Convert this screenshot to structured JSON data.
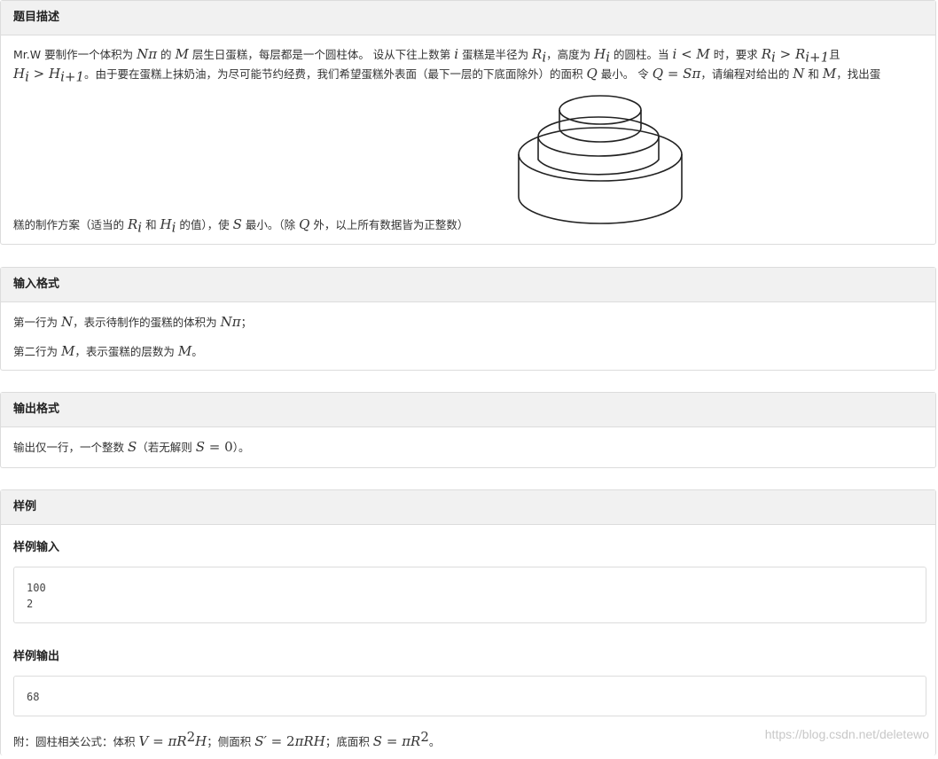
{
  "desc": {
    "header": "题目描述",
    "l1_a": "Mr.W 要制作一个体积为 ",
    "l1_b": " 的 ",
    "l1_c": " 层生日蛋糕，每层都是一个圆柱体。 设从下往上数第 ",
    "l1_d": " 蛋糕是半径为 ",
    "l1_e": "，高度为 ",
    "l1_f": " 的圆柱。当 ",
    "l1_g": " 时，要求 ",
    "l1_h": "且",
    "l2_a": "。由于要在蛋糕上抹奶油，为尽可能节约经费，我们希望蛋糕外表面（最下一层的下底面除外）的面积 ",
    "l2_b": " 最小。 令 ",
    "l2_c": "，请编程对给出的 ",
    "l2_d": " 和 ",
    "l2_e": "，找出蛋",
    "l3_a": "糕的制作方案（适当的 ",
    "l3_b": " 和 ",
    "l3_c": " 的值），使 ",
    "l3_d": " 最小。（除 ",
    "l3_e": " 外，以上所有数据皆为正整数）"
  },
  "input_format": {
    "header": "输入格式",
    "l1_a": "第一行为 ",
    "l1_b": "，表示待制作的蛋糕的体积为 ",
    "l1_c": "；",
    "l2_a": "第二行为 ",
    "l2_b": "，表示蛋糕的层数为 ",
    "l2_c": "。"
  },
  "output_format": {
    "header": "输出格式",
    "l1_a": "输出仅一行，一个整数 ",
    "l1_b": "（若无解则 ",
    "l1_c": "）。"
  },
  "sample": {
    "header": "样例",
    "input_title": "样例输入",
    "input_text": "100\n2",
    "output_title": "样例输出",
    "output_text": "68",
    "note_a": "附：圆柱相关公式：体积 ",
    "note_b": "；侧面积 ",
    "note_c": "；底面积 ",
    "note_d": "。"
  },
  "watermark": "https://blog.csdn.net/deletewo",
  "math": {
    "N": "N",
    "M": "M",
    "pi": "π",
    "i": "i",
    "R": "R",
    "H": "H",
    "Q": "Q",
    "S": "S",
    "i1": "i+1",
    "lt": " < ",
    "gt": " > ",
    "eq": " = ",
    "zero": "0",
    "V": "V",
    "two": "2",
    "Sp": "S′",
    "sq": "2"
  }
}
